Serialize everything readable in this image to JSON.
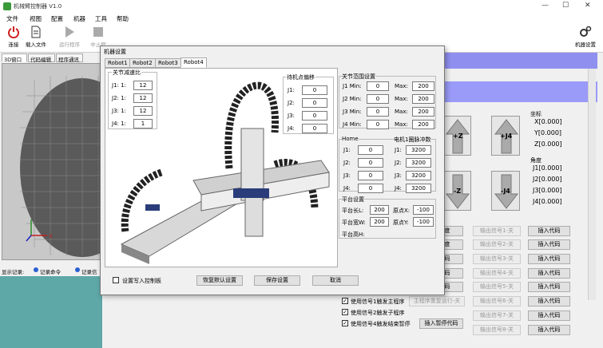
{
  "window": {
    "title": "机械臂控制器 V1.0",
    "controls": [
      "—",
      "☐",
      "✕"
    ]
  },
  "menu": [
    "文件",
    "视图",
    "配置",
    "机器",
    "工具",
    "帮助"
  ],
  "toolbar": {
    "connect": "连接",
    "load_file": "载入文件",
    "run": "运行程序",
    "stop": "中止程",
    "machine_settings": "机器设置"
  },
  "left_tabs": [
    "3D窗口",
    "代码编辑",
    "程序通讯"
  ],
  "display_record": {
    "label": "显示记录:",
    "opt1": "记录命令",
    "opt2": "记录信"
  },
  "dialog": {
    "title": "机器设置",
    "robot_tabs": [
      "Robot1",
      "Robot2",
      "Robot3",
      "Robot4"
    ],
    "reduction": {
      "title": "关节减速比",
      "rows": [
        {
          "label": "J1: 1:",
          "value": "12"
        },
        {
          "label": "J2: 1:",
          "value": "12"
        },
        {
          "label": "J3: 1:",
          "value": "12"
        },
        {
          "label": "J4: 1:",
          "value": "1"
        }
      ]
    },
    "standby": {
      "title": "待机点偏移",
      "rows": [
        {
          "label": "J1:",
          "value": "0"
        },
        {
          "label": "J2:",
          "value": "0"
        },
        {
          "label": "J3:",
          "value": "0"
        },
        {
          "label": "J4:",
          "value": "0"
        }
      ]
    },
    "range": {
      "title": "关节范围设置",
      "rows": [
        {
          "min_label": "J1 Min:",
          "min": "0",
          "max_label": "Max:",
          "max": "200"
        },
        {
          "min_label": "J2 Min:",
          "min": "0",
          "max_label": "Max:",
          "max": "200"
        },
        {
          "min_label": "J3 Min:",
          "min": "0",
          "max_label": "Max:",
          "max": "200"
        },
        {
          "min_label": "J4 Min:",
          "min": "0",
          "max_label": "Max:",
          "max": "200"
        }
      ]
    },
    "home": {
      "title": "Home",
      "motor_title": "电机1圈脉冲数",
      "rows": [
        {
          "label": "J1:",
          "value": "0",
          "m_label": "J1:",
          "m_value": "3200"
        },
        {
          "label": "J2:",
          "value": "0",
          "m_label": "J2:",
          "m_value": "3200"
        },
        {
          "label": "J3:",
          "value": "0",
          "m_label": "J3:",
          "m_value": "3200"
        },
        {
          "label": "J4:",
          "value": "0",
          "m_label": "J4:",
          "m_value": "3200"
        }
      ]
    },
    "platform": {
      "title": "平台设置",
      "length_label": "平台长L:",
      "length": "200",
      "width_label": "平台宽W:",
      "width": "200",
      "height_label": "平台高H:",
      "ox_label": "原点X:",
      "ox": "-100",
      "oy_label": "原点Y:",
      "oy": "-100"
    },
    "write_controller": "设置写入控制板",
    "restore": "恢复默认设置",
    "save": "保存设置",
    "cancel": "取消"
  },
  "coords": {
    "title": "坐标",
    "x": "X[0.000]",
    "y": "Y[0.000]",
    "z": "Z[0.000]"
  },
  "angles": {
    "title": "角度",
    "j1": "J1[0.000]",
    "j2": "J2[0.000]",
    "j3": "J3[0.000]",
    "j4": "J4[0.000]"
  },
  "jog": {
    "zplus": "+Z",
    "j4plus": "+J4",
    "zminus": "-Z",
    "j4minus": "-J4"
  },
  "output_buttons": [
    "输出信号1-关",
    "输出信号2-关",
    "输出信号3-关",
    "输出信号4-关",
    "输出信号5-关",
    "输出信号6-关",
    "输出信号7-关",
    "输出信号8-关"
  ],
  "insert_code": "插入代码",
  "signal_checks": [
    {
      "label": "使用信号1触发主程序",
      "btn": "主程序重复运行-关"
    },
    {
      "label": "使用信号2触发子程序"
    },
    {
      "label": "使用信号4触发结束暂停",
      "btn": "插入暂停代码"
    }
  ],
  "partial_labels": [
    "度",
    "度",
    "码",
    "码",
    "码",
    "码"
  ]
}
